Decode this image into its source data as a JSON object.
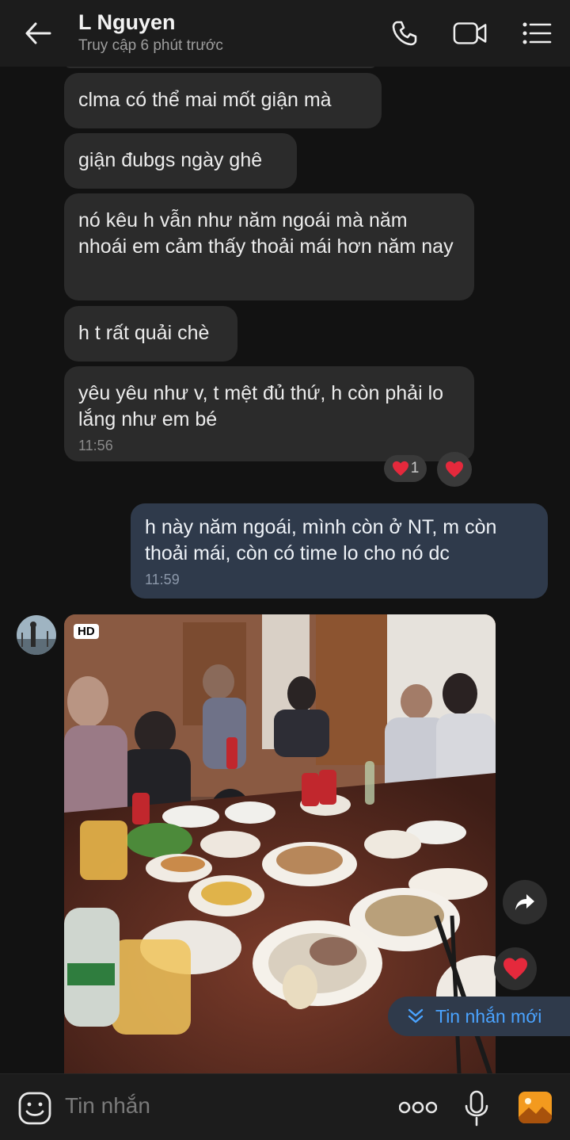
{
  "header": {
    "contact_name": "L Nguyen",
    "status": "Truy cập 6 phút trước",
    "icons": [
      "back-arrow-icon",
      "phone-icon",
      "video-call-icon",
      "menu-list-icon"
    ]
  },
  "messages": {
    "m1": "clma có thể mai mốt giận mà",
    "m2": "giận đubgs ngày ghê",
    "m3": "nó kêu h vẫn như năm ngoái mà năm nhoái em cảm thấy thoải mái hơn năm nay",
    "m4": "h t rất quải chè",
    "m5": "yêu yêu như v, t mệt đủ thứ, h còn phải lo lắng như em bé",
    "m5_time": "11:56",
    "reaction_count": "1",
    "out1": "h này năm ngoái, mình còn ở NT, m còn thoải mái, còn có time lo cho nó dc",
    "out1_time": "11:59",
    "photo_badge": "HD"
  },
  "new_message_button": "Tin nhắn mới",
  "composer": {
    "placeholder": "Tin nhắn",
    "icons": [
      "sticker-icon",
      "more-icon",
      "microphone-icon",
      "gallery-icon"
    ]
  },
  "colors": {
    "accent": "#4aa3ff",
    "bubble_in": "#2b2b2b",
    "bubble_out": "#2f3a4b",
    "heart": "#e5293c"
  }
}
